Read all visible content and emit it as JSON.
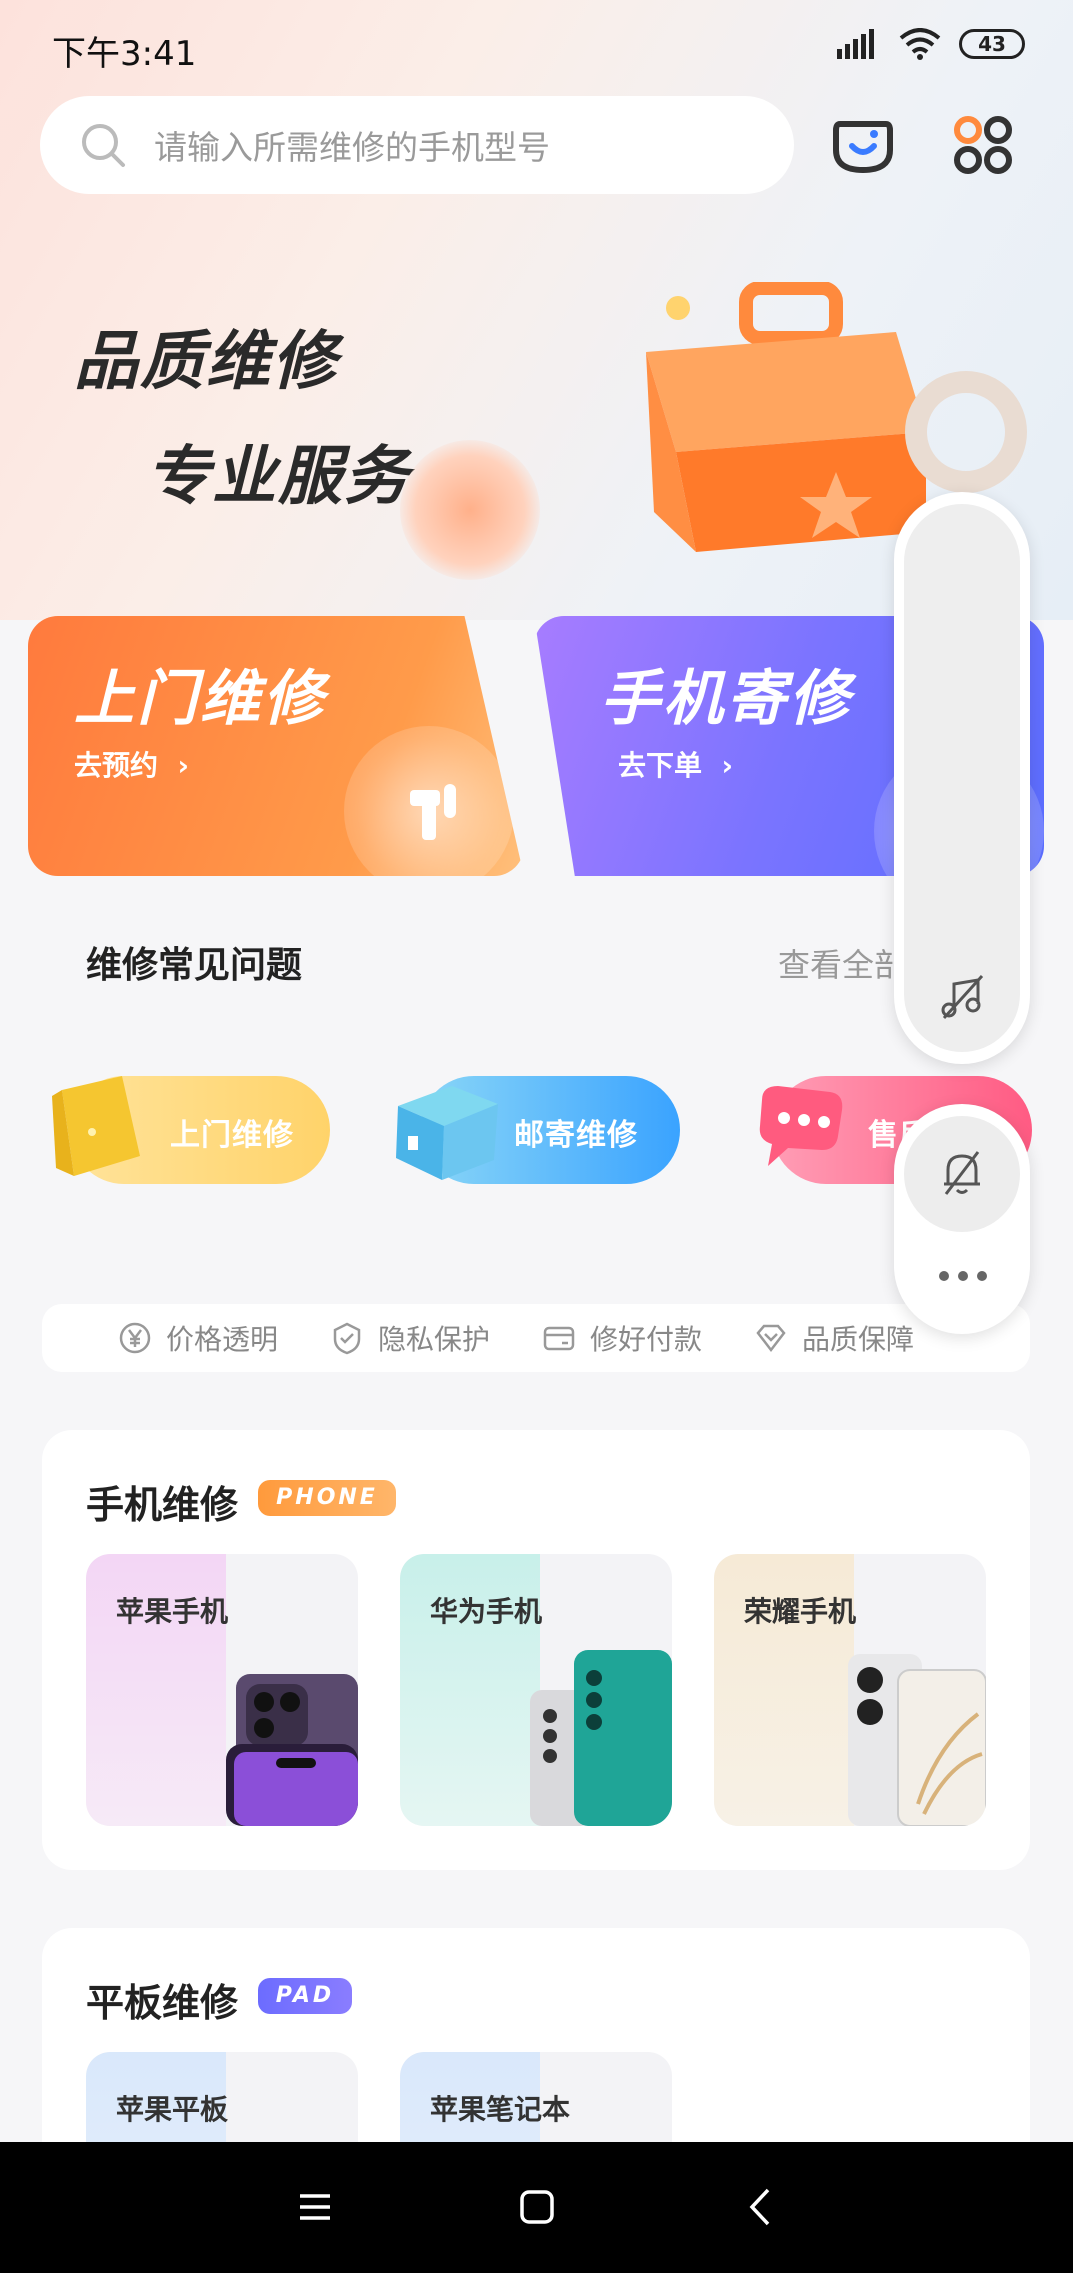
{
  "status_bar": {
    "time": "下午3:41",
    "battery": "43"
  },
  "search": {
    "placeholder": "请输入所需维修的手机型号"
  },
  "top_icons": [
    "service-icon",
    "apps-grid-icon"
  ],
  "hero": {
    "line1": "品质维修",
    "line2": "专业服务"
  },
  "service_cards": [
    {
      "title": "上门维修",
      "action": "去预约"
    },
    {
      "title": "手机寄修",
      "action": "去下单"
    }
  ],
  "faq": {
    "title": "维修常见问题",
    "more": "查看全部"
  },
  "faq_pills": [
    "上门维修",
    "邮寄维修",
    "售后"
  ],
  "guarantees": [
    "价格透明",
    "隐私保护",
    "修好付款",
    "品质保障"
  ],
  "phone_section": {
    "title": "手机维修",
    "tag": "PHONE",
    "brands": [
      "苹果手机",
      "华为手机",
      "荣耀手机"
    ]
  },
  "pad_section": {
    "title": "平板维修",
    "tag": "PAD",
    "brands": [
      "苹果平板",
      "苹果笔记本"
    ]
  },
  "colors": {
    "visit_orange": "#ff7a3d",
    "mail_purple": "#7a74ff",
    "text_dark": "#222222",
    "text_gray": "#999999"
  }
}
